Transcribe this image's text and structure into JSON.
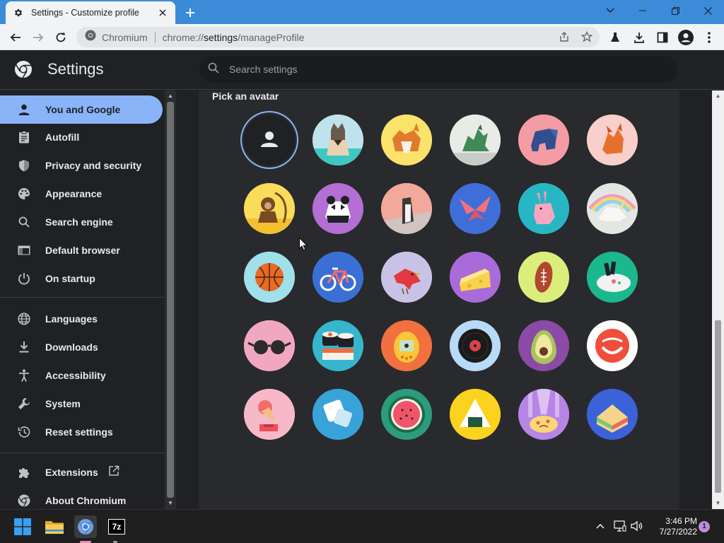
{
  "browser": {
    "tab_title": "Settings - Customize profile",
    "omnibox_site": "Chromium",
    "omnibox_url_scheme": "chrome://",
    "omnibox_url_host": "settings",
    "omnibox_url_path": "/manageProfile"
  },
  "settings": {
    "title": "Settings",
    "search_placeholder": "Search settings"
  },
  "sidebar": {
    "items": [
      {
        "label": "You and Google",
        "icon": "person-icon",
        "active": true
      },
      {
        "label": "Autofill",
        "icon": "clipboard-icon"
      },
      {
        "label": "Privacy and security",
        "icon": "shield-icon"
      },
      {
        "label": "Appearance",
        "icon": "palette-icon"
      },
      {
        "label": "Search engine",
        "icon": "search-icon"
      },
      {
        "label": "Default browser",
        "icon": "browser-window-icon"
      },
      {
        "label": "On startup",
        "icon": "power-icon"
      },
      {
        "label": "Languages",
        "icon": "globe-icon"
      },
      {
        "label": "Downloads",
        "icon": "download-icon"
      },
      {
        "label": "Accessibility",
        "icon": "accessibility-icon"
      },
      {
        "label": "System",
        "icon": "wrench-icon"
      },
      {
        "label": "Reset settings",
        "icon": "history-icon"
      },
      {
        "label": "Extensions",
        "icon": "puzzle-icon"
      },
      {
        "label": "About Chromium",
        "icon": "chromium-logo-icon"
      }
    ]
  },
  "main": {
    "section_title": "Pick an avatar",
    "avatars": [
      {
        "name": "generic-person",
        "bg": "#202124",
        "selected": true
      },
      {
        "name": "cat",
        "bg": "#bfe3ec"
      },
      {
        "name": "corgi",
        "bg": "#fbe26b"
      },
      {
        "name": "dragon",
        "bg": "#e9ebe7"
      },
      {
        "name": "elephant",
        "bg": "#f59ba3"
      },
      {
        "name": "fox",
        "bg": "#f8cfca"
      },
      {
        "name": "monkey",
        "bg": "#f9dc5a"
      },
      {
        "name": "panda",
        "bg": "#b36fd3"
      },
      {
        "name": "penguin",
        "bg": "#f2a89a"
      },
      {
        "name": "butterfly",
        "bg": "#3f6ed8"
      },
      {
        "name": "rabbit",
        "bg": "#27b7c4"
      },
      {
        "name": "unicorn",
        "bg": "#e4e6e3"
      },
      {
        "name": "basketball",
        "bg": "#9fe0ea"
      },
      {
        "name": "bike",
        "bg": "#3a6fd6"
      },
      {
        "name": "bird",
        "bg": "#c8c3e6"
      },
      {
        "name": "cheese",
        "bg": "#a96bd9"
      },
      {
        "name": "football",
        "bg": "#dbee7c"
      },
      {
        "name": "sushi-plate",
        "bg": "#1bb78e"
      },
      {
        "name": "sunglasses",
        "bg": "#f2a7c1"
      },
      {
        "name": "sushi",
        "bg": "#35b6cc"
      },
      {
        "name": "tamagotchi",
        "bg": "#f1703e"
      },
      {
        "name": "vinyl",
        "bg": "#b6daf7"
      },
      {
        "name": "avocado",
        "bg": "#8b4aa6"
      },
      {
        "name": "smiley",
        "bg": "#ffffff"
      },
      {
        "name": "ice-cream",
        "bg": "#f7b9c8"
      },
      {
        "name": "origami",
        "bg": "#38a3d8"
      },
      {
        "name": "watermelon",
        "bg": "#2c9c7c"
      },
      {
        "name": "onigiri",
        "bg": "#fbd21e"
      },
      {
        "name": "pizza",
        "bg": "#b785e6"
      },
      {
        "name": "sandwich",
        "bg": "#3b62d8"
      }
    ]
  },
  "taskbar": {
    "time": "3:46 PM",
    "date": "7/27/2022",
    "notifications": "1",
    "apps": [
      "windows-start-icon",
      "file-explorer-icon",
      "chromium-icon",
      "7zip-icon"
    ],
    "app_7zip_label": "7z"
  }
}
